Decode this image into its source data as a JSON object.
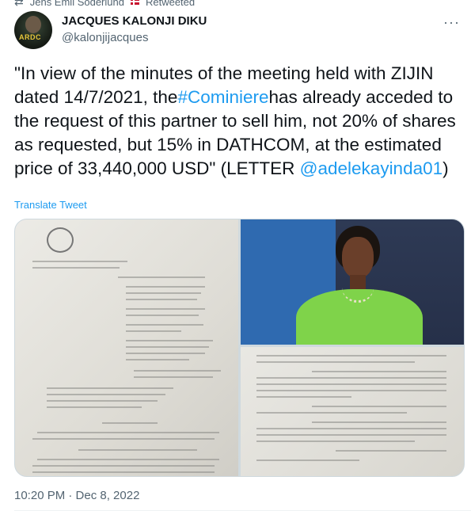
{
  "retweet": {
    "text": "Jens Emil Söderlund",
    "suffix": "Retweeted"
  },
  "author": {
    "name": "JACQUES KALONJI DIKU",
    "handle": "@kalonjijacques",
    "avatar_label": "ARDC"
  },
  "tweet": {
    "part1": "\"In view of the minutes of the meeting held with ZIJIN dated 14/7/2021, the",
    "hashtag": "#Cominiere",
    "part2": "has already acceded to the request of this partner to sell him, not 20% of shares as requested, but 15% in DATHCOM, at the estimated price of 33,440,000 USD\" (LETTER ",
    "mention": "@adelekayinda01",
    "part3": ")"
  },
  "translate_label": "Translate Tweet",
  "timestamp": "10:20 PM · Dec 8, 2022",
  "colors": {
    "link": "#1d9bf0",
    "muted": "#536471",
    "text": "#0f1419"
  }
}
